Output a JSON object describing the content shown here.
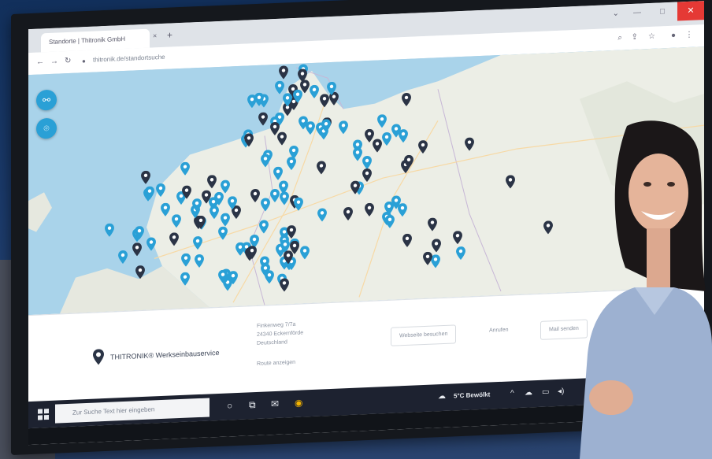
{
  "browser": {
    "tab_title": "Standorte | Thitronik GmbH",
    "tab_close": "×",
    "new_tab": "+",
    "url": "thitronik.de/standortsuche",
    "nav_back": "←",
    "nav_forward": "→",
    "nav_reload": "↻",
    "win_min": "⌄",
    "win_restore": "—",
    "win_max": "□",
    "win_close": "✕"
  },
  "map": {
    "controls": [
      {
        "icon": "filter-icon",
        "glyph": "⚯"
      },
      {
        "icon": "location-icon",
        "glyph": "⌾"
      }
    ],
    "pin_colors": {
      "partner": "#2aa0d6",
      "service": "#2b3446"
    }
  },
  "panel": {
    "company": "THITRONIK® Werkseinbauservice",
    "address_lines": [
      "Finkenweg 7/7a",
      "24340 Eckernförde",
      "Deutschland"
    ],
    "route_link": "Route anzeigen",
    "website_button": "Webseite besuchen",
    "call_link": "Anrufen",
    "email_button": "Mail senden"
  },
  "taskbar": {
    "search_placeholder": "Zur Suche Text hier eingeben",
    "weather": "5°C Bewölkt",
    "tray_caret": "^"
  },
  "colors": {
    "accent": "#2aa0d6",
    "dark_pin": "#2b3446",
    "backdrop": "#14305f"
  }
}
